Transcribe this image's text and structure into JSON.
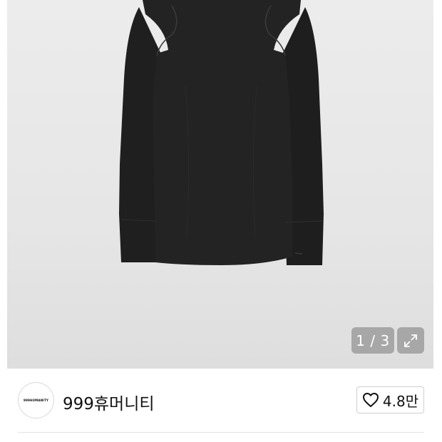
{
  "gallery": {
    "image_alt": "black long sleeve top",
    "counter": "1 / 3",
    "expand_icon": "expand-icon"
  },
  "seller": {
    "avatar_text": "999HUMANITY",
    "name": "999휴머니티",
    "like_icon": "heart-outline-icon",
    "like_count": "4.8만"
  }
}
